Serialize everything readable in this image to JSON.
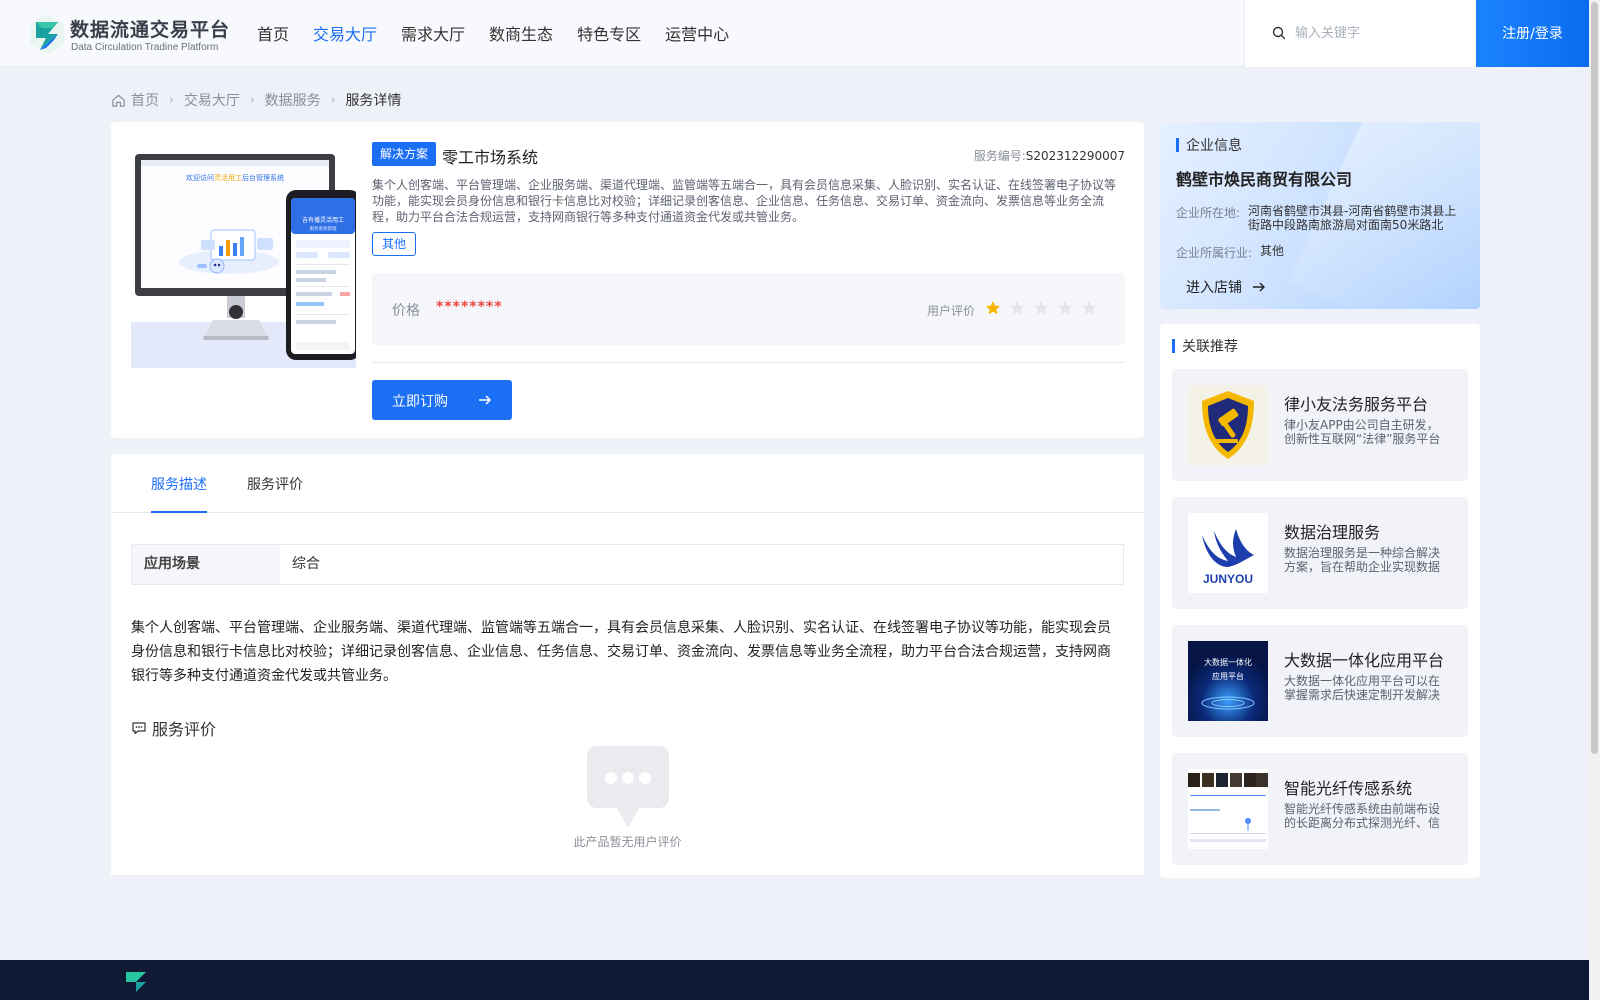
{
  "header": {
    "logo_title": "数据流通交易平台",
    "logo_sub": "Data Circulation Tradine Platform",
    "nav": [
      "首页",
      "交易大厅",
      "需求大厅",
      "数商生态",
      "特色专区",
      "运营中心"
    ],
    "active_nav": "交易大厅",
    "search_placeholder": "输入关键字",
    "login_label": "注册/登录",
    "accent_color": "#1b6ff5"
  },
  "breadcrumb": [
    "首页",
    "交易大厅",
    "数据服务",
    "服务详情"
  ],
  "product": {
    "tag": "解决方案",
    "title": "零工市场系统",
    "code_label": "服务编号:",
    "code_value": "S202312290007",
    "description": "集个人创客端、平台管理端、企业服务端、渠道代理端、监管端等五端合一，具有会员信息采集、人脸识别、实名认证、在线签署电子协议等功能，能实现会员身份信息和银行卡信息比对校验；详细记录创客信息、企业信息、任务信息、交易订单、资金流向、发票信息等业务全流程，助力平台合法合规运营，支持网商银行等多种支付通道资金代发或共管业务。",
    "category_tag": "其他",
    "price_label": "价格",
    "price_value": "********",
    "rating_label": "用户评价",
    "rating": 1,
    "rating_max": 5,
    "buy_label": "立即订购",
    "image_texts": {
      "welcome_a": "欢迎访问",
      "welcome_b": "灵活用工",
      "welcome_c": "后台管理系统",
      "phone_title": "吉有播灵活用工",
      "phone_sub": "服务系统管理"
    }
  },
  "tabs": [
    "服务描述",
    "服务评价"
  ],
  "active_tab": "服务描述",
  "attributes": [
    {
      "key": "应用场景",
      "value": "综合"
    }
  ],
  "long_description": "集个人创客端、平台管理端、企业服务端、渠道代理端、监管端等五端合一，具有会员信息采集、人脸识别、实名认证、在线签署电子协议等功能，能实现会员身份信息和银行卡信息比对校验；详细记录创客信息、企业信息、任务信息、交易订单、资金流向、发票信息等业务全流程，助力平台合法合规运营，支持网商银行等多种支付通道资金代发或共管业务。",
  "reviews": {
    "title": "服务评价",
    "empty_text": "此产品暂无用户评价"
  },
  "company": {
    "section_title": "企业信息",
    "name": "鹤壁市焕民商贸有限公司",
    "location_label": "企业所在地:",
    "location_value": "河南省鹤壁市淇县-河南省鹤壁市淇县上街路中段路南旅游局对面南50米路北",
    "industry_label": "企业所属行业:",
    "industry_value": "其他",
    "shop_link": "进入店铺"
  },
  "recommendations": {
    "section_title": "关联推荐",
    "items": [
      {
        "name": "律小友法务服务平台",
        "desc": "律小友APP由公司自主研发，创新性互联网“法律”服务平台"
      },
      {
        "name": "数据治理服务",
        "desc": "数据治理服务是一种综合解决方案，旨在帮助企业实现数据资产的有效管理",
        "thumb_text": "JUNYOU"
      },
      {
        "name": "大数据一体化应用平台",
        "desc": "大数据一体化应用平台可以在掌握需求后快速定制开发解决方案",
        "thumb_text_a": "大数据一体化",
        "thumb_text_b": "应用平台"
      },
      {
        "name": "智能光纤传感系统",
        "desc": "智能光纤传感系统由前端布设的长距离分布式探测光纤、信号处理主机组成"
      }
    ]
  }
}
